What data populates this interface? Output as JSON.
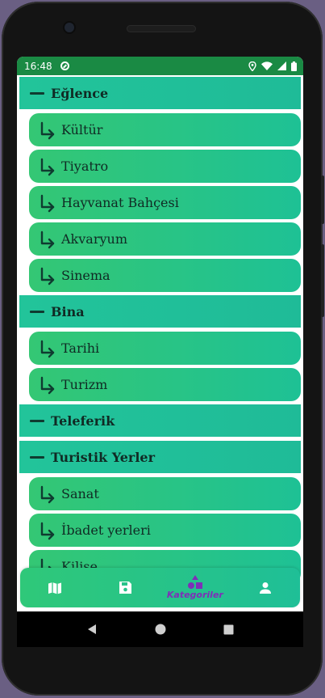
{
  "status": {
    "time": "16:48"
  },
  "categories": [
    {
      "label": "Eğlence",
      "subs": [
        "Kültür",
        "Tiyatro",
        "Hayvanat Bahçesi",
        "Akvaryum",
        "Sinema"
      ]
    },
    {
      "label": "Bina",
      "subs": [
        "Tarihi",
        "Turizm"
      ]
    },
    {
      "label": "Teleferik",
      "subs": []
    },
    {
      "label": "Turistik Yerler",
      "subs": [
        "Sanat",
        "İbadet yerleri",
        "Kilise"
      ]
    }
  ],
  "navbar": {
    "items": [
      {
        "icon": "map-icon",
        "label": ""
      },
      {
        "icon": "save-icon",
        "label": ""
      },
      {
        "icon": "categories-icon",
        "label": "Kategoriler"
      },
      {
        "icon": "person-icon",
        "label": ""
      }
    ],
    "active_color": "#7e2fb8"
  },
  "colors": {
    "statusbar": "#1a8a44",
    "category": "#22c49a",
    "sub_start": "#34c774",
    "sub_end": "#1ec195"
  }
}
